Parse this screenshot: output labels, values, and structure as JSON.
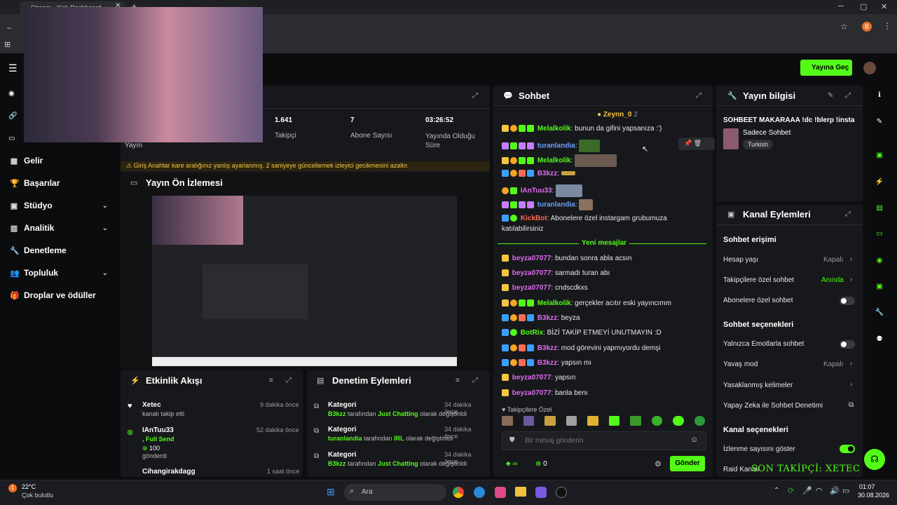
{
  "browser": {
    "tab_title": "Stream - Kick Dashboard",
    "profile_letter": "B"
  },
  "header": {
    "go_live": "Yayına Geç"
  },
  "sidebar": {
    "items": [
      {
        "label": "Gelir",
        "chevron": false
      },
      {
        "label": "Başarılar",
        "chevron": false
      },
      {
        "label": "Stüdyo",
        "chevron": true
      },
      {
        "label": "Analitik",
        "chevron": true
      },
      {
        "label": "Denetleme",
        "chevron": false
      },
      {
        "label": "Topluluk",
        "chevron": true
      },
      {
        "label": "Droplar ve ödüller",
        "chevron": false
      }
    ]
  },
  "stats": {
    "yayin_label": "Yayın",
    "followers": "1.641",
    "followers_label": "Takipçi",
    "subs": "7",
    "subs_label": "Abone Sayısı",
    "uptime": "03:26:52",
    "uptime_label": "Yayında Olduğu Süre"
  },
  "warning": "Giriş Anahtar kare aralığınız yanlış ayarlanmış. 2 saniyeye güncellemek izleyici gecikmesini azaltır.",
  "preview": {
    "title": "Yayın Ön İzlemesi"
  },
  "activity": {
    "title": "Etkinlik Akışı",
    "items": [
      {
        "name": "Xetec",
        "desc": "kanalı takip etti",
        "time": "9 dakika önce"
      },
      {
        "name": "IAnTuu33",
        "desc": ", Full Send",
        "extra": "100",
        "extra2": "gönderdi",
        "time": "52 dakika önce"
      },
      {
        "name": "Cihangirakdagg",
        "time": "1 saat önce"
      }
    ]
  },
  "moderation": {
    "title": "Denetim Eylemleri",
    "items": [
      {
        "title": "Kategori",
        "user": "B3kzz",
        "mid": "tarafından",
        "cat": "Just Chatting",
        "end": "olarak değiştirildi",
        "time": "34 dakika önce"
      },
      {
        "title": "Kategori",
        "user": "turanlandia",
        "mid": "tarafından",
        "cat": "IRL",
        "end": "olarak değiştirildi",
        "time": "34 dakika önce"
      },
      {
        "title": "Kategori",
        "user": "B3kzz",
        "mid": "tarafından",
        "cat": "Just Chatting",
        "end": "olarak değiştirildi",
        "time": "34 dakika önce"
      }
    ]
  },
  "chat": {
    "title": "Sohbet",
    "pinned_user": "Zeynn_0",
    "pinned_count": "2",
    "messages": [
      {
        "user": "Melalkolik",
        "text": ": bunun da gifini yapsanıza :')",
        "color": "g"
      },
      {
        "user": "turanlandia",
        "text": ":",
        "color": "b"
      },
      {
        "user": "Melalkolik",
        "text": ":",
        "color": "g"
      },
      {
        "user": "B3kzz",
        "text": ":",
        "color": "p"
      },
      {
        "user": "IAnTuu33",
        "text": ":",
        "color": "p"
      },
      {
        "user": "turanlandia",
        "text": ":",
        "color": "b"
      },
      {
        "user": "KickBot",
        "text": ": Abonelere özel instargam grubumuza",
        "color": "r"
      }
    ],
    "kickbot_line2": "katılabilirsiniz",
    "new_messages": "Yeni mesajlar",
    "messages2": [
      {
        "user": "beyza07077",
        "text": ": bundan sonra abla acsın",
        "color": "p"
      },
      {
        "user": "beyza07077",
        "text": ": sarmadı turan abı",
        "color": "p"
      },
      {
        "user": "beyza07077",
        "text": ": cndscdkxs",
        "color": "p"
      },
      {
        "user": "Melalkolik",
        "text": ": gerçekler acıtır eski yayıncımm",
        "color": "g"
      },
      {
        "user": "B3kzz",
        "text": ": beyza",
        "color": "p"
      },
      {
        "user": "BotRix",
        "text": ": BİZİ TAKİP ETMEYİ UNUTMAYIN :D",
        "color": "g"
      },
      {
        "user": "B3kzz",
        "text": ": mod görevini yapmıyordu demşi",
        "color": "p"
      },
      {
        "user": "B3kzz",
        "text": ": yapsın mı",
        "color": "p"
      },
      {
        "user": "beyza07077",
        "text": ": yapsın",
        "color": "p"
      },
      {
        "user": "beyza07077",
        "text": ": banla benı",
        "color": "p"
      }
    ],
    "followers_only": "Takipçilere Özel",
    "placeholder": "Bir mesaj gönderin",
    "points": "0",
    "send": "Gönder"
  },
  "stream_info": {
    "title": "Yayın bilgisi",
    "stream_title": "SOHBEET MAKARAAA !dc !blerp !insta",
    "category": "Sadece Sohbet",
    "language": "Turkish"
  },
  "channel_actions": {
    "title": "Kanal Eylemleri",
    "chat_access": "Sohbet erişimi",
    "account_age": "Hesap yaşı",
    "account_age_val": "Kapalı",
    "followers_chat": "Takipçilere özel sohbet",
    "followers_chat_val": "Anında",
    "subs_chat": "Abonelere özel sohbet",
    "chat_options": "Sohbet seçenekleri",
    "emote_only": "Yalnızca Emotlarla sohbet",
    "slow_mode": "Yavaş mod",
    "slow_mode_val": "Kapalı",
    "banned_words": "Yasaklanmış kelimeler",
    "ai_mod": "Yapay Zeka ile Sohbet Denetimi",
    "channel_options": "Kanal seçenekleri",
    "viewer_count": "İzlenme sayısını göster",
    "raid": "Raid Kanalı"
  },
  "overlay_text": "SON TAKİPÇİ: XETEC",
  "taskbar": {
    "temp": "22°C",
    "weather": "Çok bulutlu",
    "search": "Ara",
    "time": "01:07",
    "date": "30.08.2026",
    "notif": "1"
  },
  "colors": {
    "accent": "#53fc18",
    "bg": "#0d0e10",
    "panel": "#17181b"
  }
}
